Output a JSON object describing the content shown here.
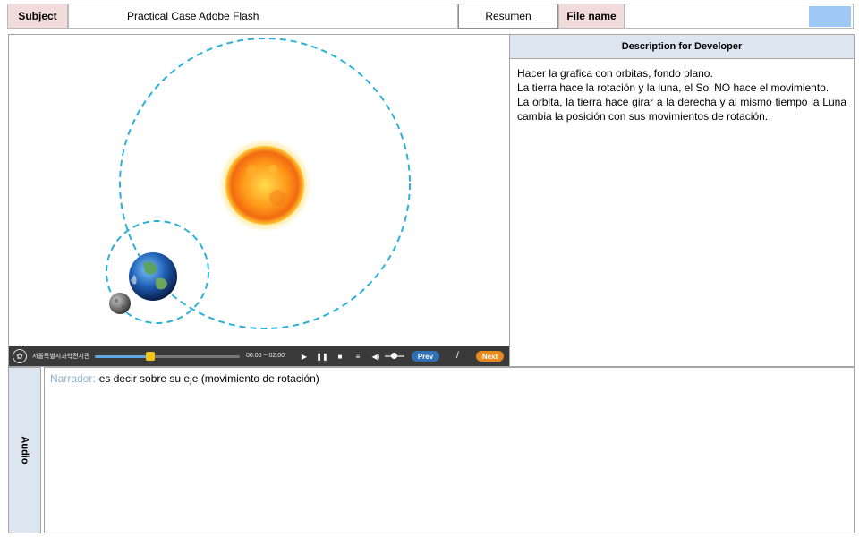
{
  "header": {
    "subject_label": "Subject",
    "subject_value": "Practical Case Adobe Flash",
    "summary_label": "Resumen",
    "filename_label": "File name",
    "filename_value": ""
  },
  "colors": {
    "label_bg": "#f2dcdb",
    "panel_header_bg": "#dde5f0",
    "orbit_dash": "#2bb0d8",
    "filename_swatch": "#9ec9f6",
    "player_bar": "#3a3a3a",
    "prev_button": "#2e6fb5",
    "next_button": "#e8891c"
  },
  "stage": {
    "scene_items": [
      "sun",
      "earth",
      "moon",
      "earth-orbit",
      "moon-orbit"
    ],
    "player": {
      "org_text": "서울특별시과학전시관",
      "time": "00:00 ~ 02:00",
      "progress_fraction": 0.38,
      "icons": [
        "logo-icon",
        "play-icon",
        "pause-icon",
        "stop-icon",
        "menu-icon",
        "volume-icon"
      ],
      "prev_label": "Prev",
      "separator": "/",
      "next_label": "Next"
    }
  },
  "description": {
    "title": "Description for Developer",
    "lines": [
      "Hacer la grafica con orbitas, fondo plano.",
      "La tierra hace la rotación y la luna, el Sol NO hace el movimiento.",
      "La orbita, la tierra hace girar a la derecha  y al mismo tiempo la Luna cambia la posición con sus movimientos de rotación."
    ]
  },
  "audio": {
    "tab_label": "Audio",
    "narrator_label": "Narrador:",
    "narration_text": "es decir sobre su eje (movimiento de rotación)"
  }
}
